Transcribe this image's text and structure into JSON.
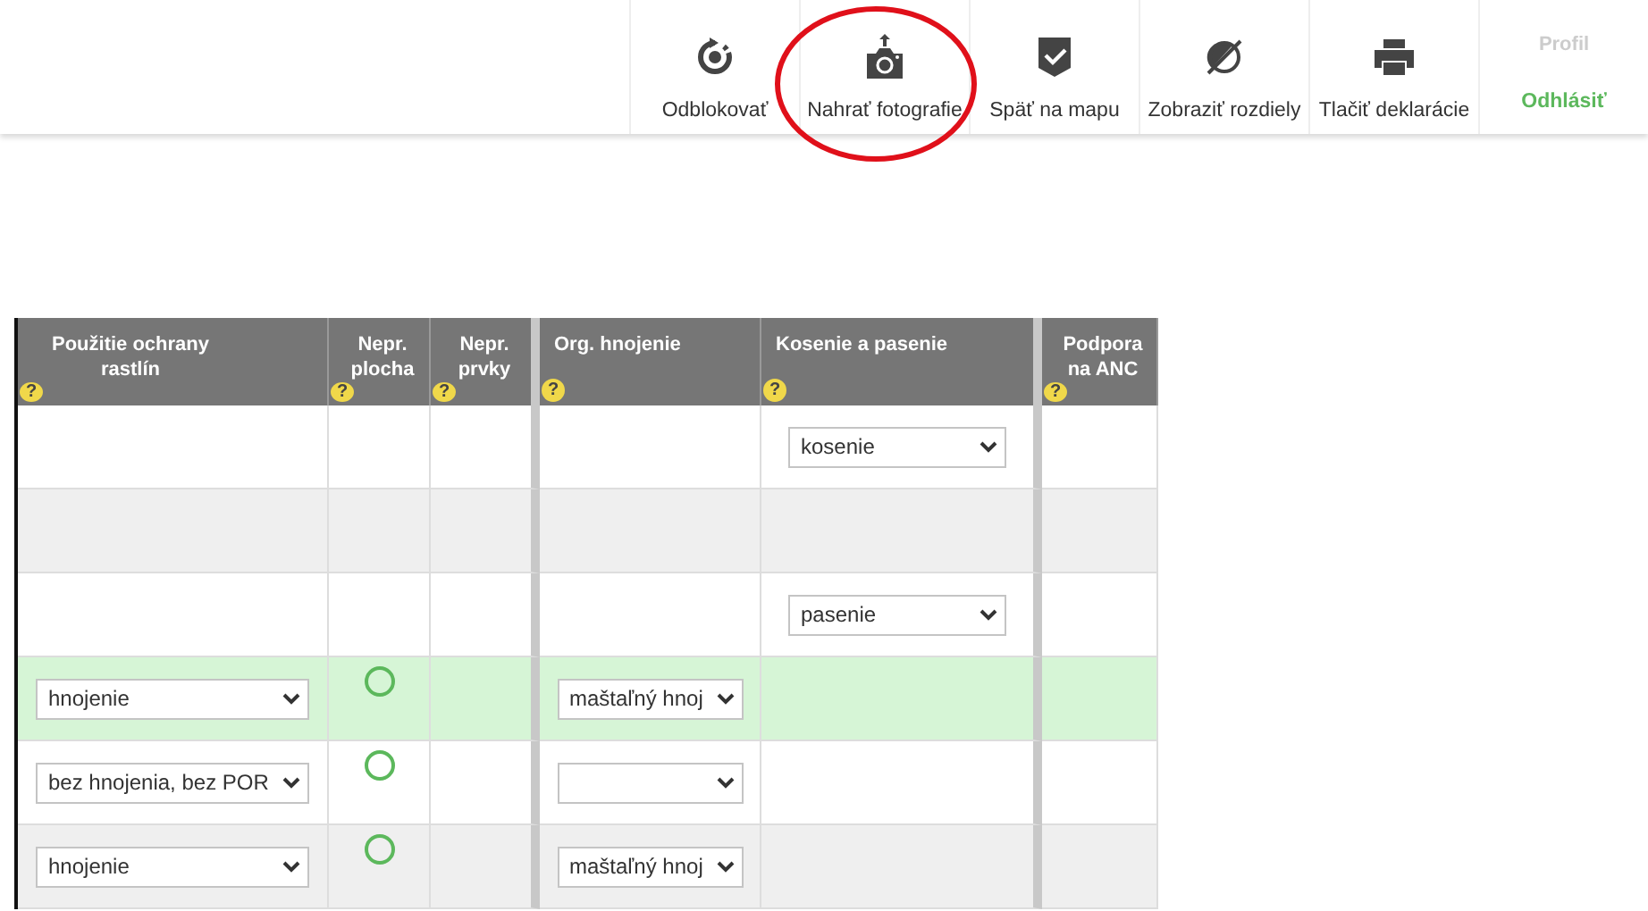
{
  "toolbar": {
    "actions": [
      {
        "kind": "unlock",
        "label": "Odblokovať"
      },
      {
        "kind": "photo",
        "label": "Nahrať fotografie"
      },
      {
        "kind": "map",
        "label": "Späť na mapu"
      },
      {
        "kind": "diff",
        "label": "Zobraziť rozdiely"
      },
      {
        "kind": "print",
        "label": "Tlačiť deklarácie"
      }
    ],
    "profile": {
      "label": "Profil",
      "logout": "Odhlásiť"
    }
  },
  "table": {
    "columns": [
      {
        "label": "Použitie ochrany rastlín",
        "help": "?"
      },
      {
        "label": "Nepr. plocha",
        "help": "?"
      },
      {
        "label": "Nepr. prvky",
        "help": "?"
      },
      {
        "label": "Org. hnojenie",
        "help": "?"
      },
      {
        "label": "Kosenie a pasenie",
        "help": "?"
      },
      {
        "label": "Podpora na ANC",
        "help": "?"
      }
    ],
    "rows": [
      {
        "selected": false,
        "mowing": {
          "kind": "select",
          "value": "kosenie"
        }
      },
      {
        "selected": false
      },
      {
        "selected": false,
        "mowing": {
          "kind": "select",
          "value": "pasenie"
        }
      },
      {
        "selected": true,
        "plant_protection": {
          "kind": "select",
          "value": "hnojenie"
        },
        "area_circle": true,
        "fertilizer": {
          "kind": "select",
          "value": "maštaľný hnoj"
        }
      },
      {
        "selected": false,
        "plant_protection": {
          "kind": "select",
          "value": "bez hnojenia, bez POR"
        },
        "area_circle": true,
        "fertilizer": {
          "kind": "select"
        }
      },
      {
        "selected": false,
        "plant_protection": {
          "kind": "select",
          "value": "hnojenie"
        },
        "area_circle": true,
        "fertilizer": {
          "kind": "select",
          "value": "maštaľný hnoj"
        }
      }
    ]
  }
}
